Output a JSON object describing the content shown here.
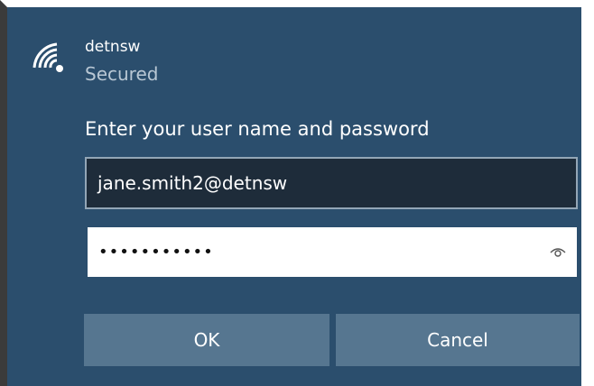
{
  "network": {
    "ssid": "detnsw",
    "status": "Secured",
    "icon": "wifi-secured-icon"
  },
  "form": {
    "prompt": "Enter your user name and password",
    "username_value": "jane.smith2@detnsw",
    "password_masked": "•••••••••••",
    "reveal_icon": "eye-icon"
  },
  "buttons": {
    "ok_label": "OK",
    "cancel_label": "Cancel"
  },
  "colors": {
    "panel_bg": "#2b4e6d",
    "button_bg": "#567690",
    "input_dark_bg": "#1e2c3a"
  }
}
